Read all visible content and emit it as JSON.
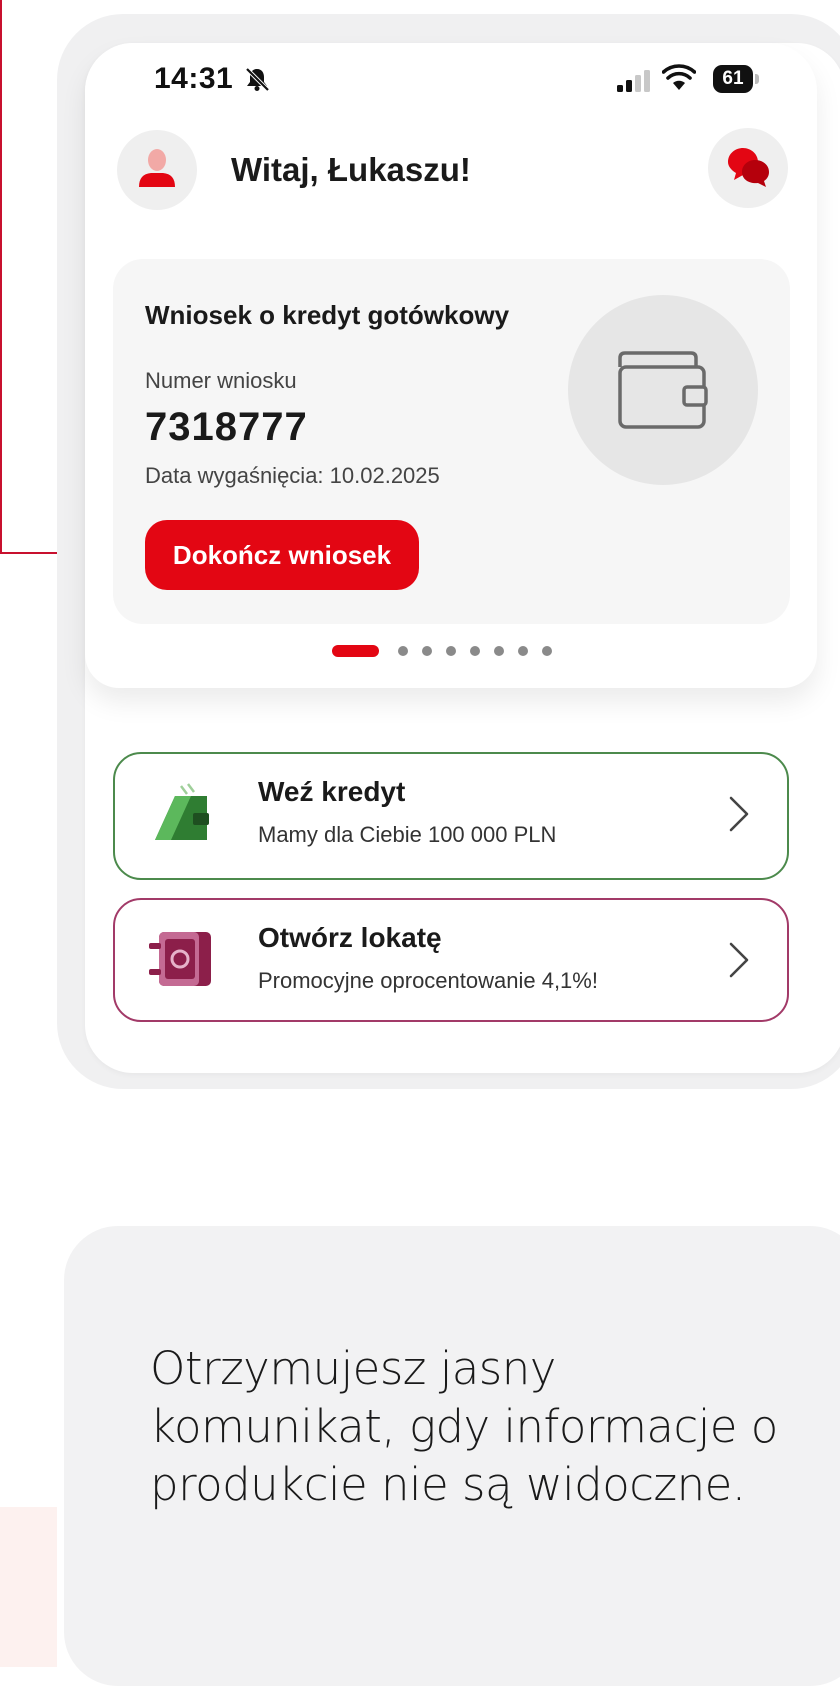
{
  "status_bar": {
    "time": "14:31",
    "battery": "61"
  },
  "header": {
    "greeting": "Witaj, Łukaszu!"
  },
  "application_card": {
    "title": "Wniosek o kredyt gotówkowy",
    "number_label": "Numer wniosku",
    "number": "7318777",
    "expiry": "Data wygaśnięcia: 10.02.2025",
    "button_label": "Dokończ wniosek"
  },
  "pager": {
    "total": 8,
    "active_index": 0
  },
  "offers": [
    {
      "title": "Weź kredyt",
      "subtitle": "Mamy dla Ciebie 100 000 PLN",
      "icon": "wallet-icon",
      "border_color": "#4c8a4c"
    },
    {
      "title": "Otwórz lokatę",
      "subtitle": "Promocyjne oprocentowanie 4,1%!",
      "icon": "safe-icon",
      "border_color": "#a23a68"
    }
  ],
  "info": {
    "text": "Otrzymujesz jasny komunikat, gdy informacje o produkcie nie są widoczne."
  },
  "colors": {
    "accent": "#e30613",
    "connector": "#c8102e"
  }
}
